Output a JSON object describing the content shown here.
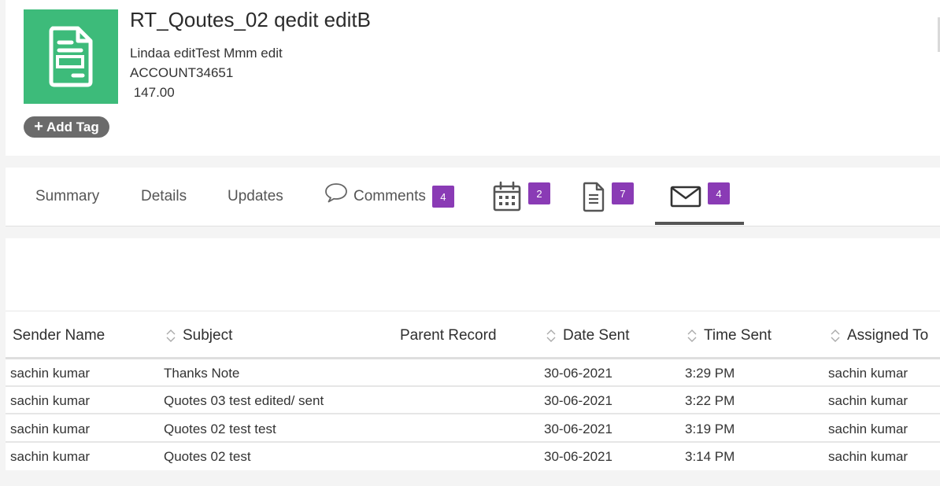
{
  "record": {
    "icon": "document-icon",
    "title": "RT_Qoutes_02 qedit editB",
    "contact": "Lindaa editTest Mmm edit",
    "account": "ACCOUNT34651",
    "amount": " 147.00",
    "add_tag_label": "Add Tag",
    "accent_color": "#3dbb7a"
  },
  "tabs": {
    "summary": "Summary",
    "details": "Details",
    "updates": "Updates",
    "comments": "Comments",
    "comments_count": "4",
    "calendar_count": "2",
    "documents_count": "7",
    "emails_count": "4",
    "badge_color": "#8a3bb5",
    "active_tab": "emails"
  },
  "email_table": {
    "columns": {
      "sender_name": "Sender Name",
      "subject": "Subject",
      "parent_record": "Parent Record",
      "date_sent": "Date Sent",
      "time_sent": "Time Sent",
      "assigned_to": "Assigned To"
    },
    "rows": [
      {
        "sender": "sachin kumar",
        "subject": "Thanks Note",
        "parent": "",
        "date": "30-06-2021",
        "time": "3:29 PM",
        "assigned": "sachin kumar"
      },
      {
        "sender": "sachin kumar",
        "subject": "Quotes 03 test edited/ sent",
        "parent": "",
        "date": "30-06-2021",
        "time": "3:22 PM",
        "assigned": "sachin kumar"
      },
      {
        "sender": "sachin kumar",
        "subject": "Quotes 02 test test",
        "parent": "",
        "date": "30-06-2021",
        "time": "3:19 PM",
        "assigned": "sachin kumar"
      },
      {
        "sender": "sachin kumar",
        "subject": "Quotes 02 test",
        "parent": "",
        "date": "30-06-2021",
        "time": "3:14 PM",
        "assigned": "sachin kumar"
      }
    ]
  }
}
